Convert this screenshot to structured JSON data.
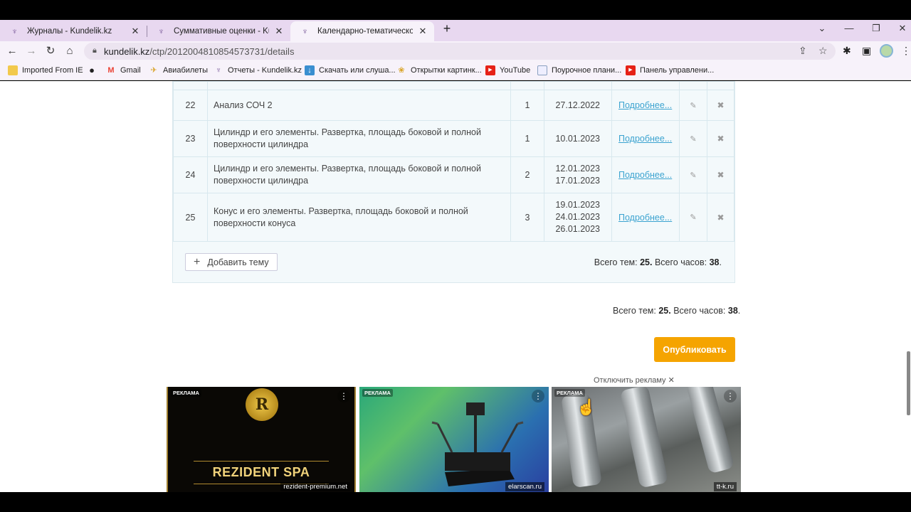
{
  "browser": {
    "tabs": [
      {
        "title": "Журналы - Kundelik.kz",
        "active": false
      },
      {
        "title": "Суммативные оценки - Kundelik.kz",
        "active": false
      },
      {
        "title": "Календарно-тематическое план",
        "active": true
      }
    ],
    "url_host": "kundelik.kz",
    "url_path": "/ctp/2012004810854573731/details",
    "bookmarks": [
      {
        "label": "Imported From IE",
        "icon": "folder-icon",
        "color": "#f2c94c"
      },
      {
        "label": "",
        "icon": "globe-icon",
        "color": "#222222"
      },
      {
        "label": "Gmail",
        "icon": "gmail-icon",
        "color": "#ea4335"
      },
      {
        "label": "Авиабилеты",
        "icon": "plane-icon",
        "color": "#d9a326"
      },
      {
        "label": "Отчеты - Kundelik.kz",
        "icon": "kundelik-icon",
        "color": "#7a5a9a"
      },
      {
        "label": "Скачать или слуша...",
        "icon": "download-icon",
        "color": "#3a8fd0"
      },
      {
        "label": "Открытки картинк...",
        "icon": "card-icon",
        "color": "#d9a326"
      },
      {
        "label": "YouTube",
        "icon": "youtube-icon",
        "color": "#e62117"
      },
      {
        "label": "Поурочное плани...",
        "icon": "doc-icon",
        "color": "#8aa0c0"
      },
      {
        "label": "Панель управлени...",
        "icon": "youtube-icon",
        "color": "#e62117"
      }
    ]
  },
  "table": {
    "more_label": "Подробнее...",
    "rows": [
      {
        "num": "22",
        "name": "Анализ СОЧ 2",
        "hours": "1",
        "dates": [
          "27.12.2022"
        ]
      },
      {
        "num": "23",
        "name": "Цилиндр и его элементы. Развертка, площадь боковой и полной поверхности цилиндра",
        "hours": "1",
        "dates": [
          "10.01.2023"
        ]
      },
      {
        "num": "24",
        "name": "Цилиндр и его элементы. Развертка, площадь боковой и полной поверхности цилиндра",
        "hours": "2",
        "dates": [
          "12.01.2023",
          "17.01.2023"
        ]
      },
      {
        "num": "25",
        "name": "Конус и его элементы. Развертка, площадь боковой и полной поверхности конуса",
        "hours": "3",
        "dates": [
          "19.01.2023",
          "24.01.2023",
          "26.01.2023"
        ]
      }
    ]
  },
  "add_topic_label": "Добавить тему",
  "totals": {
    "topics_label": "Всего тем:",
    "topics_value": "25.",
    "hours_label": "Всего часов:",
    "hours_value": "38",
    "end": "."
  },
  "publish_label": "Опубликовать",
  "ads": {
    "disable_label": "Отключить рекламу",
    "label": "РЕКЛАМА",
    "items": [
      {
        "brand": "REZIDENT SPA",
        "logo_letter": "R",
        "domain": "rezident-premium.net"
      },
      {
        "brand": "",
        "domain": "elarscan.ru"
      },
      {
        "brand": "",
        "domain": "tt-k.ru"
      }
    ]
  }
}
